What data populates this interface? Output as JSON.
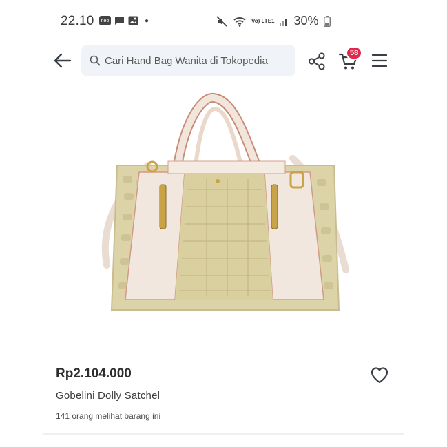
{
  "status_bar": {
    "time": "22.10",
    "neo_label": "neo",
    "network_label": "Vo) LTE1",
    "battery": "30%"
  },
  "header": {
    "search_placeholder": "Cari Hand Bag Wanita di Tokopedia",
    "cart_count": "58"
  },
  "product": {
    "price": "Rp2.104.000",
    "name": "Gobelini Dolly Satchel",
    "viewers_text": "141 orang melihat barang ini"
  },
  "colors": {
    "badge": "#e3264b",
    "search_bg": "#f0f3f7",
    "icon": "#3a3f47"
  },
  "icons": [
    "back-arrow-icon",
    "search-icon",
    "share-icon",
    "cart-icon",
    "menu-icon",
    "heart-icon"
  ]
}
